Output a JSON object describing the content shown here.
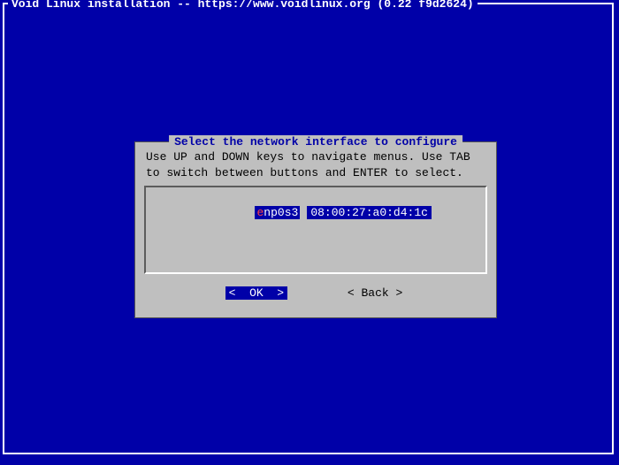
{
  "window": {
    "title": "Void Linux installation -- https://www.voidlinux.org (0.22 f9d2624)"
  },
  "dialog": {
    "title": "Select the network interface to configure",
    "help": "Use UP and DOWN keys to navigate menus. Use TAB to switch between buttons and ENTER to select.",
    "interfaces": [
      {
        "name_hot": "e",
        "name_rest": "np0s3",
        "mac": "08:00:27:a0:d4:1c"
      }
    ],
    "buttons": {
      "ok": "<  OK  >",
      "back": "< Back >"
    }
  }
}
